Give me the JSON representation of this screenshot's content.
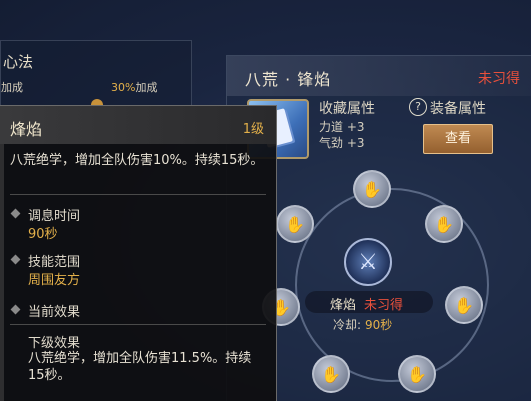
{
  "background_panel": {
    "title": "心法",
    "bonus_left": "加成",
    "bonus_right_pct": "30%",
    "bonus_right_suffix": "加成"
  },
  "skill_panel": {
    "title": "八荒 · 锋焰",
    "status": "未习得",
    "collect_attr_label": "收藏属性",
    "stats": [
      {
        "label": "力道",
        "value": "+3"
      },
      {
        "label": "气劲",
        "value": "+3"
      }
    ],
    "help_icon": "?",
    "equip_attr_label": "装备属性",
    "view_button": "查看"
  },
  "meridian": {
    "center_name": "烽焰",
    "center_status": "未习得",
    "cooldown_label": "冷却:",
    "cooldown_value": "90秒",
    "node_icons": [
      "hand-icon",
      "hand-icon",
      "hand-icon",
      "hand-icon",
      "hand-icon",
      "hand-icon",
      "hand-icon",
      "hand-icon"
    ]
  },
  "tooltip": {
    "title": "烽焰",
    "level": "1级",
    "description": "八荒绝学，增加全队伤害10%。持续15秒。",
    "sections": [
      {
        "label": "调息时间",
        "value": "90秒"
      },
      {
        "label": "技能范围",
        "value": "周围友方"
      },
      {
        "label": "当前效果",
        "value": ""
      }
    ],
    "next_label": "下级效果",
    "next_description": "八荒绝学，增加全队伤害11.5%。持续15秒。"
  },
  "colors": {
    "status_red": "#e8503c",
    "gold": "#e3b04a",
    "button_brown": "#a87040"
  }
}
